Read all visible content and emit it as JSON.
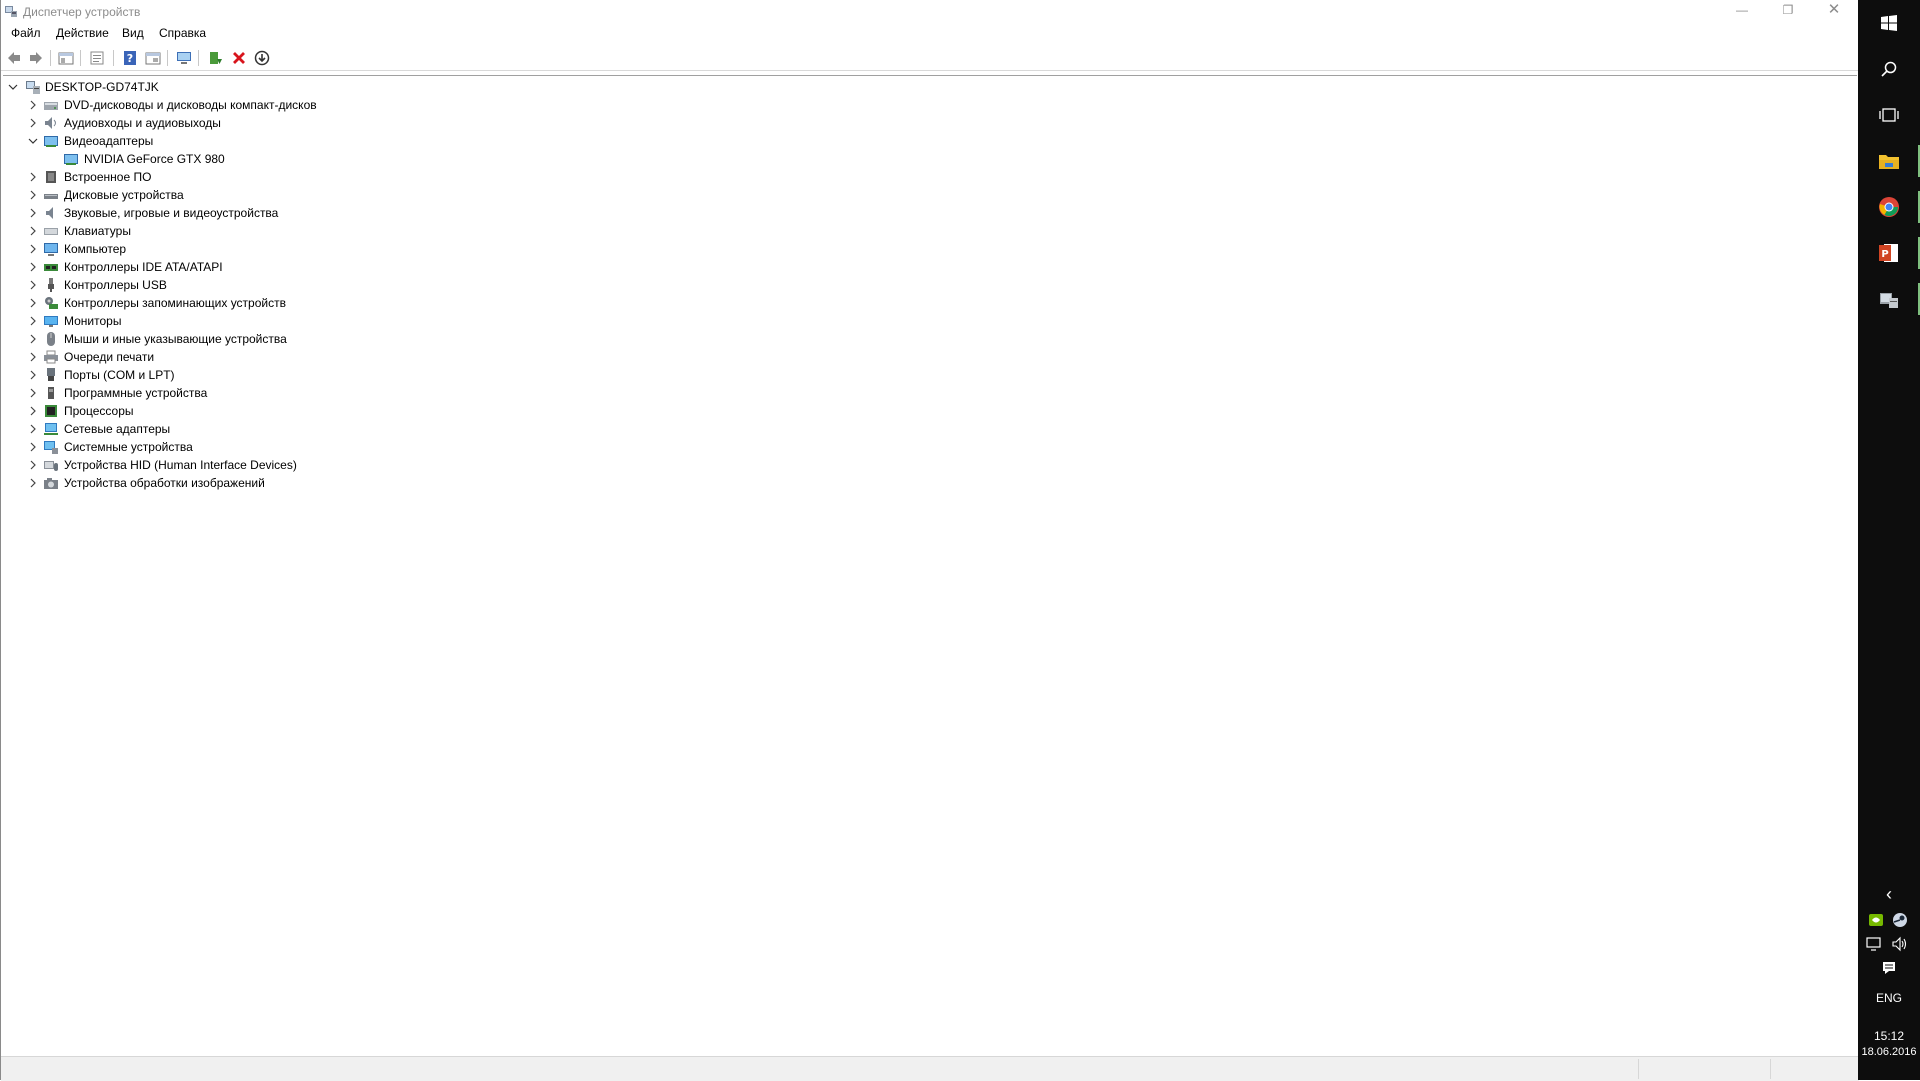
{
  "window": {
    "title": "Диспетчер устройств",
    "controls": {
      "minimize": "—",
      "maximize": "❐",
      "close": "✕"
    }
  },
  "menu": [
    "Файл",
    "Действие",
    "Вид",
    "Справка"
  ],
  "toolbar": {
    "buttons": [
      "back-icon",
      "forward-icon",
      "console-tree-icon",
      "properties-icon",
      "help-icon",
      "view-icon",
      "scan-hardware-icon",
      "update-driver-icon",
      "uninstall-icon",
      "download-icon"
    ]
  },
  "tree": {
    "root": "DESKTOP-GD74TJK",
    "items": [
      {
        "label": "DVD-дисководы и дисководы компакт-дисков",
        "icon": "dvd-drive-icon",
        "expanded": false
      },
      {
        "label": "Аудиовходы и аудиовыходы",
        "icon": "audio-icon",
        "expanded": false
      },
      {
        "label": "Видеоадаптеры",
        "icon": "display-adapter-icon",
        "expanded": true,
        "children": [
          "NVIDIA GeForce GTX 980"
        ]
      },
      {
        "label": "Встроенное ПО",
        "icon": "firmware-icon",
        "expanded": false
      },
      {
        "label": "Дисковые устройства",
        "icon": "disk-drive-icon",
        "expanded": false
      },
      {
        "label": "Звуковые, игровые и видеоустройства",
        "icon": "sound-icon",
        "expanded": false
      },
      {
        "label": "Клавиатуры",
        "icon": "keyboard-icon",
        "expanded": false
      },
      {
        "label": "Компьютер",
        "icon": "computer-icon",
        "expanded": false
      },
      {
        "label": "Контроллеры IDE ATA/ATAPI",
        "icon": "ide-controller-icon",
        "expanded": false
      },
      {
        "label": "Контроллеры USB",
        "icon": "usb-icon",
        "expanded": false
      },
      {
        "label": "Контроллеры запоминающих устройств",
        "icon": "storage-controller-icon",
        "expanded": false
      },
      {
        "label": "Мониторы",
        "icon": "monitor-icon",
        "expanded": false
      },
      {
        "label": "Мыши и иные указывающие устройства",
        "icon": "mouse-icon",
        "expanded": false
      },
      {
        "label": "Очереди печати",
        "icon": "printer-icon",
        "expanded": false
      },
      {
        "label": "Порты (COM и LPT)",
        "icon": "port-icon",
        "expanded": false
      },
      {
        "label": "Программные устройства",
        "icon": "software-device-icon",
        "expanded": false
      },
      {
        "label": "Процессоры",
        "icon": "processor-icon",
        "expanded": false
      },
      {
        "label": "Сетевые адаптеры",
        "icon": "network-adapter-icon",
        "expanded": false
      },
      {
        "label": "Системные устройства",
        "icon": "system-device-icon",
        "expanded": false
      },
      {
        "label": "Устройства HID (Human Interface Devices)",
        "icon": "hid-icon",
        "expanded": false
      },
      {
        "label": "Устройства обработки изображений",
        "icon": "imaging-icon",
        "expanded": false
      }
    ]
  },
  "taskbar": {
    "apps": [
      "start-icon",
      "search-icon",
      "task-view-icon",
      "file-explorer-icon",
      "chrome-icon",
      "powerpoint-icon",
      "device-manager-icon"
    ],
    "tray_chevron": "‹",
    "language": "ENG",
    "time": "15:12",
    "date": "18.06.2016"
  },
  "colors": {
    "taskbar_bg": "#0d0d0d",
    "title_text": "#8c8c8c",
    "accent_active": "#7fbf7f"
  }
}
